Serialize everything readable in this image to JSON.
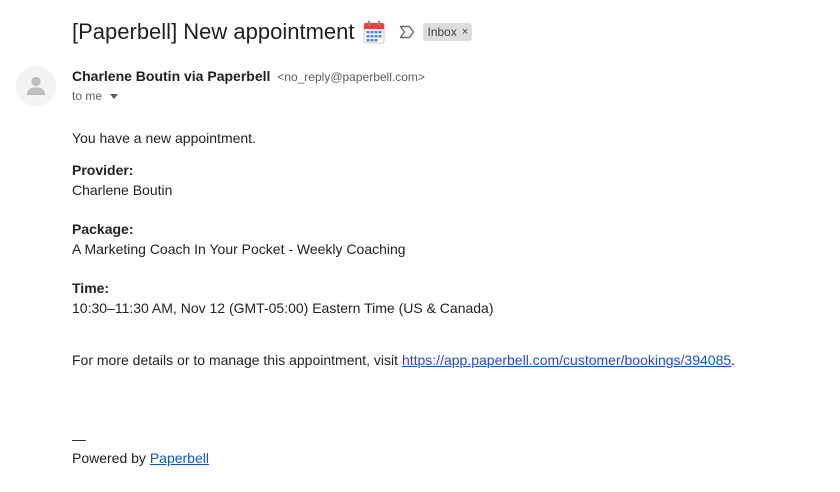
{
  "email": {
    "subject": "[Paperbell] New appointment",
    "label": "Inbox",
    "label_remove": "×",
    "sender_name": "Charlene Boutin via Paperbell",
    "sender_email": "<no_reply@paperbell.com>",
    "recipient": "to me"
  },
  "body": {
    "intro": "You have a new appointment.",
    "provider_label": "Provider:",
    "provider_value": "Charlene Boutin",
    "package_label": "Package:",
    "package_value": "A Marketing Coach In Your Pocket - Weekly Coaching",
    "time_label": "Time:",
    "time_value": "10:30–11:30 AM, Nov 12 (GMT-05:00) Eastern Time (US & Canada)",
    "details_prefix": "For more details or to manage this appointment, visit ",
    "details_link": "https://app.paperbell.com/customer/bookings/394085",
    "details_suffix": ".",
    "signature_dash": "—",
    "powered_prefix": "Powered by ",
    "powered_link": "Paperbell"
  },
  "icons": {
    "calendar": "calendar-icon",
    "important": "important-marker-icon",
    "avatar": "default-avatar-icon",
    "caret": "caret-down-icon"
  },
  "colors": {
    "link": "#1155cc",
    "chip_bg": "#dddddd",
    "avatar_bg": "#f1f3f4",
    "calendar_header": "#e8453c",
    "calendar_grid": "#4a86e8"
  }
}
